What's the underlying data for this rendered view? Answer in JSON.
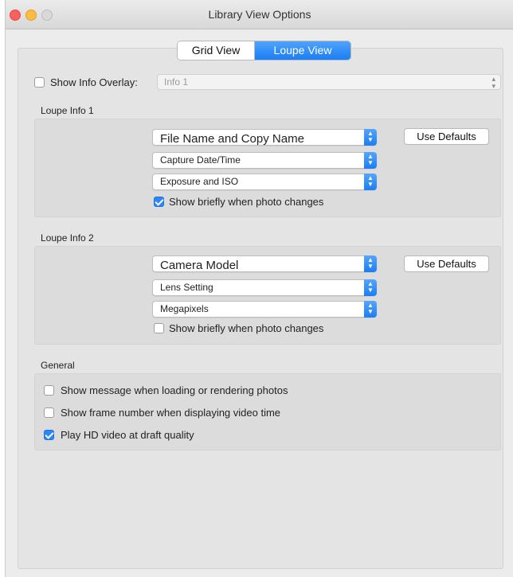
{
  "window": {
    "title": "Library View Options"
  },
  "tabs": {
    "grid": "Grid View",
    "loupe": "Loupe View"
  },
  "overlay": {
    "label": "Show Info Overlay:",
    "value": "Info 1",
    "checked": false
  },
  "loupe1": {
    "title": "Loupe Info 1",
    "field1": "File Name and Copy Name",
    "field2": "Capture Date/Time",
    "field3": "Exposure and ISO",
    "show_briefly": "Show briefly when photo changes",
    "show_briefly_checked": true,
    "defaults": "Use Defaults"
  },
  "loupe2": {
    "title": "Loupe Info 2",
    "field1": "Camera Model",
    "field2": "Lens Setting",
    "field3": "Megapixels",
    "show_briefly": "Show briefly when photo changes",
    "show_briefly_checked": false,
    "defaults": "Use Defaults"
  },
  "general": {
    "title": "General",
    "opt1": "Show message when loading or rendering photos",
    "opt1_checked": false,
    "opt2": "Show frame number when displaying video time",
    "opt2_checked": false,
    "opt3": "Play HD video at draft quality",
    "opt3_checked": true
  },
  "colors": {
    "accent": "#1a7ef5",
    "window_bg": "#ececec",
    "panel_bg": "#dcdcdc"
  }
}
